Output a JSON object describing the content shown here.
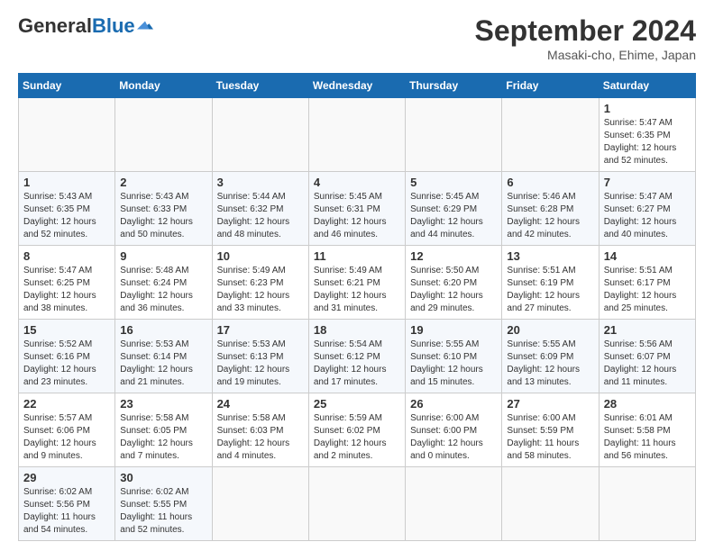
{
  "header": {
    "logo_general": "General",
    "logo_blue": "Blue",
    "title": "September 2024",
    "location": "Masaki-cho, Ehime, Japan"
  },
  "calendar": {
    "days_of_week": [
      "Sunday",
      "Monday",
      "Tuesday",
      "Wednesday",
      "Thursday",
      "Friday",
      "Saturday"
    ],
    "weeks": [
      [
        null,
        null,
        null,
        null,
        null,
        null,
        {
          "day": 1,
          "sunrise": "5:47 AM",
          "sunset": "6:35 PM",
          "daylight": "12 hours and 52 minutes."
        }
      ],
      [
        {
          "day": 1,
          "sunrise": "5:43 AM",
          "sunset": "6:35 PM",
          "daylight": "12 hours and 52 minutes."
        },
        {
          "day": 2,
          "sunrise": "5:43 AM",
          "sunset": "6:33 PM",
          "daylight": "12 hours and 50 minutes."
        },
        {
          "day": 3,
          "sunrise": "5:44 AM",
          "sunset": "6:32 PM",
          "daylight": "12 hours and 48 minutes."
        },
        {
          "day": 4,
          "sunrise": "5:45 AM",
          "sunset": "6:31 PM",
          "daylight": "12 hours and 46 minutes."
        },
        {
          "day": 5,
          "sunrise": "5:45 AM",
          "sunset": "6:29 PM",
          "daylight": "12 hours and 44 minutes."
        },
        {
          "day": 6,
          "sunrise": "5:46 AM",
          "sunset": "6:28 PM",
          "daylight": "12 hours and 42 minutes."
        },
        {
          "day": 7,
          "sunrise": "5:47 AM",
          "sunset": "6:27 PM",
          "daylight": "12 hours and 40 minutes."
        }
      ],
      [
        {
          "day": 8,
          "sunrise": "5:47 AM",
          "sunset": "6:25 PM",
          "daylight": "12 hours and 38 minutes."
        },
        {
          "day": 9,
          "sunrise": "5:48 AM",
          "sunset": "6:24 PM",
          "daylight": "12 hours and 36 minutes."
        },
        {
          "day": 10,
          "sunrise": "5:49 AM",
          "sunset": "6:23 PM",
          "daylight": "12 hours and 33 minutes."
        },
        {
          "day": 11,
          "sunrise": "5:49 AM",
          "sunset": "6:21 PM",
          "daylight": "12 hours and 31 minutes."
        },
        {
          "day": 12,
          "sunrise": "5:50 AM",
          "sunset": "6:20 PM",
          "daylight": "12 hours and 29 minutes."
        },
        {
          "day": 13,
          "sunrise": "5:51 AM",
          "sunset": "6:19 PM",
          "daylight": "12 hours and 27 minutes."
        },
        {
          "day": 14,
          "sunrise": "5:51 AM",
          "sunset": "6:17 PM",
          "daylight": "12 hours and 25 minutes."
        }
      ],
      [
        {
          "day": 15,
          "sunrise": "5:52 AM",
          "sunset": "6:16 PM",
          "daylight": "12 hours and 23 minutes."
        },
        {
          "day": 16,
          "sunrise": "5:53 AM",
          "sunset": "6:14 PM",
          "daylight": "12 hours and 21 minutes."
        },
        {
          "day": 17,
          "sunrise": "5:53 AM",
          "sunset": "6:13 PM",
          "daylight": "12 hours and 19 minutes."
        },
        {
          "day": 18,
          "sunrise": "5:54 AM",
          "sunset": "6:12 PM",
          "daylight": "12 hours and 17 minutes."
        },
        {
          "day": 19,
          "sunrise": "5:55 AM",
          "sunset": "6:10 PM",
          "daylight": "12 hours and 15 minutes."
        },
        {
          "day": 20,
          "sunrise": "5:55 AM",
          "sunset": "6:09 PM",
          "daylight": "12 hours and 13 minutes."
        },
        {
          "day": 21,
          "sunrise": "5:56 AM",
          "sunset": "6:07 PM",
          "daylight": "12 hours and 11 minutes."
        }
      ],
      [
        {
          "day": 22,
          "sunrise": "5:57 AM",
          "sunset": "6:06 PM",
          "daylight": "12 hours and 9 minutes."
        },
        {
          "day": 23,
          "sunrise": "5:58 AM",
          "sunset": "6:05 PM",
          "daylight": "12 hours and 7 minutes."
        },
        {
          "day": 24,
          "sunrise": "5:58 AM",
          "sunset": "6:03 PM",
          "daylight": "12 hours and 4 minutes."
        },
        {
          "day": 25,
          "sunrise": "5:59 AM",
          "sunset": "6:02 PM",
          "daylight": "12 hours and 2 minutes."
        },
        {
          "day": 26,
          "sunrise": "6:00 AM",
          "sunset": "6:00 PM",
          "daylight": "12 hours and 0 minutes."
        },
        {
          "day": 27,
          "sunrise": "6:00 AM",
          "sunset": "5:59 PM",
          "daylight": "11 hours and 58 minutes."
        },
        {
          "day": 28,
          "sunrise": "6:01 AM",
          "sunset": "5:58 PM",
          "daylight": "11 hours and 56 minutes."
        }
      ],
      [
        {
          "day": 29,
          "sunrise": "6:02 AM",
          "sunset": "5:56 PM",
          "daylight": "11 hours and 54 minutes."
        },
        {
          "day": 30,
          "sunrise": "6:02 AM",
          "sunset": "5:55 PM",
          "daylight": "11 hours and 52 minutes."
        },
        null,
        null,
        null,
        null,
        null
      ]
    ]
  }
}
